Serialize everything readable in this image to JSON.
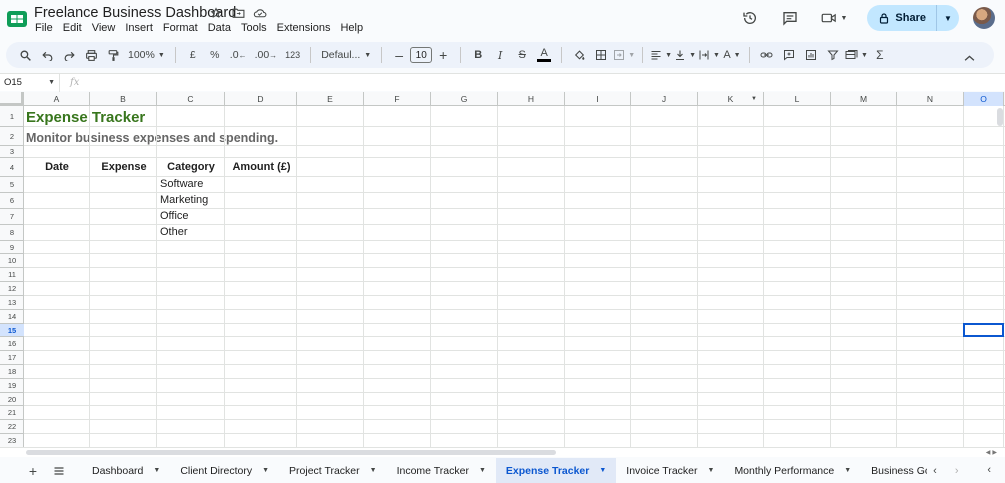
{
  "header": {
    "title": "Freelance Business Dashboard",
    "menus": [
      "File",
      "Edit",
      "View",
      "Insert",
      "Format",
      "Data",
      "Tools",
      "Extensions",
      "Help"
    ],
    "share_label": "Share"
  },
  "toolbar": {
    "zoom": "100%",
    "currency": "£",
    "percent": "%",
    "dec_minus": ".0",
    "dec_plus": ".00",
    "number_format": "123",
    "font": "Defaul...",
    "font_size": "10"
  },
  "formula_bar": {
    "cell_ref": "O15",
    "fx": "fx",
    "content": ""
  },
  "grid": {
    "columns": [
      "A",
      "B",
      "C",
      "D",
      "E",
      "F",
      "G",
      "H",
      "I",
      "J",
      "K",
      "L",
      "M",
      "N",
      "O"
    ],
    "rows": [
      "1",
      "2",
      "3",
      "4",
      "5",
      "6",
      "7",
      "8",
      "9",
      "10",
      "11",
      "12",
      "13",
      "14",
      "15",
      "16",
      "17",
      "18",
      "19",
      "20",
      "21",
      "22",
      "23"
    ],
    "selected_cell": "O15",
    "content": {
      "title": "Expense Tracker",
      "subtitle": "Monitor business expenses and spending.",
      "headers": [
        "Date",
        "Expense",
        "Category",
        "Amount (£)"
      ],
      "categories": [
        "Software",
        "Marketing",
        "Office",
        "Other"
      ]
    },
    "colors": {
      "title": "#38761d",
      "subtitle": "#666666",
      "accent": "#0b57d0"
    }
  },
  "sheets": {
    "tabs": [
      "Dashboard",
      "Client Directory",
      "Project Tracker",
      "Income Tracker",
      "Expense Tracker",
      "Invoice Tracker",
      "Monthly Performance",
      "Business Go"
    ],
    "active": "Expense Tracker"
  }
}
